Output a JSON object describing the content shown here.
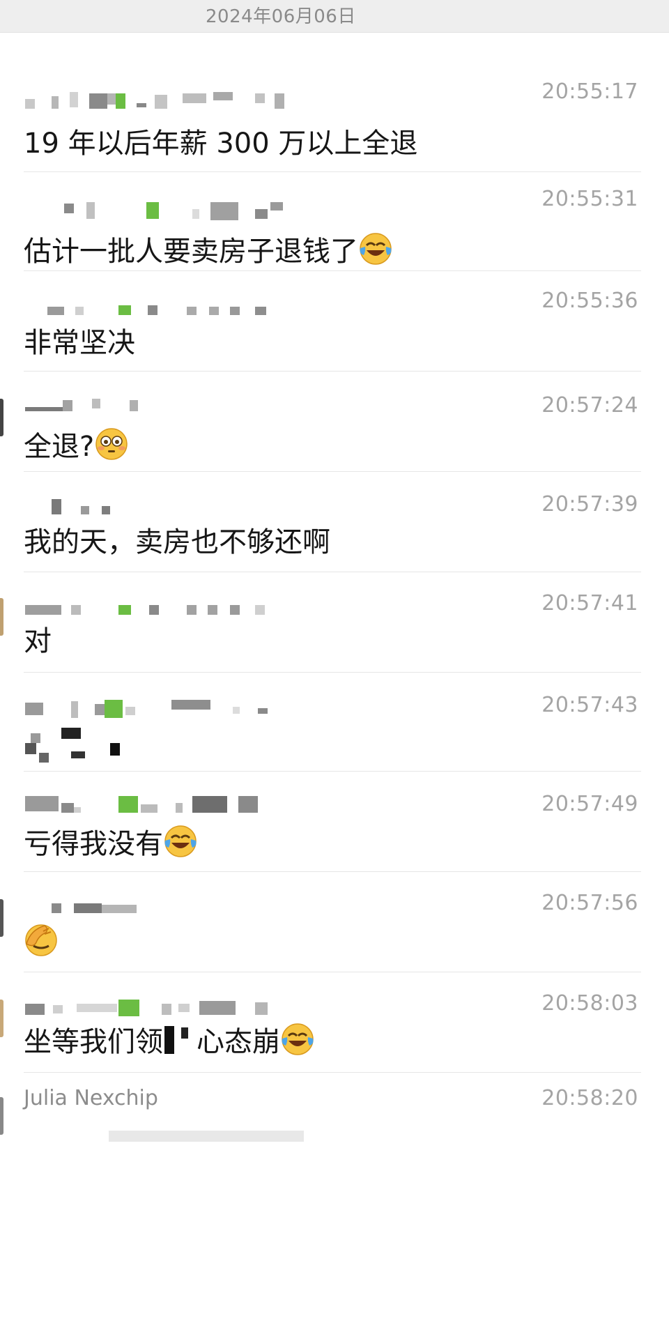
{
  "date_header": "2024年06月06日",
  "messages": [
    {
      "time": "20:55:17",
      "text": "19 年以后年薪 300 万以上全退",
      "emoji": ""
    },
    {
      "time": "20:55:31",
      "text": "估计一批人要卖房子退钱了",
      "emoji": "tears-of-joy"
    },
    {
      "time": "20:55:36",
      "text": "非常坚决",
      "emoji": ""
    },
    {
      "time": "20:57:24",
      "text": "全退?",
      "emoji": "flushed"
    },
    {
      "time": "20:57:39",
      "text": "我的天，卖房也不够还啊",
      "emoji": ""
    },
    {
      "time": "20:57:41",
      "text": "对",
      "emoji": ""
    },
    {
      "time": "20:57:43",
      "text": "",
      "emoji": ""
    },
    {
      "time": "20:57:49",
      "text": "亏得我没有",
      "emoji": "tears-of-joy"
    },
    {
      "time": "20:57:56",
      "text": "",
      "emoji": "facepalm"
    },
    {
      "time": "20:58:03",
      "text_before": "坐等我们领",
      "text_after": "心态崩",
      "emoji": "tears-of-joy"
    },
    {
      "time": "20:58:20",
      "sender": "Julia Nexchip",
      "text": "",
      "emoji": ""
    }
  ],
  "colors": {
    "header_bg": "#eeeeee",
    "green_pixel": "#7ec24a",
    "timestamp": "#a4a4a4"
  }
}
